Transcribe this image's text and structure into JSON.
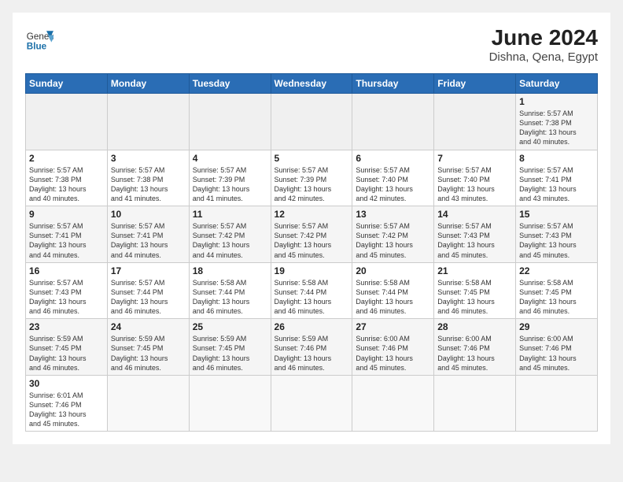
{
  "header": {
    "logo_general": "General",
    "logo_blue": "Blue",
    "month_title": "June 2024",
    "location": "Dishna, Qena, Egypt"
  },
  "weekdays": [
    "Sunday",
    "Monday",
    "Tuesday",
    "Wednesday",
    "Thursday",
    "Friday",
    "Saturday"
  ],
  "weeks": [
    [
      {
        "day": "",
        "info": ""
      },
      {
        "day": "",
        "info": ""
      },
      {
        "day": "",
        "info": ""
      },
      {
        "day": "",
        "info": ""
      },
      {
        "day": "",
        "info": ""
      },
      {
        "day": "",
        "info": ""
      },
      {
        "day": "1",
        "info": "Sunrise: 5:57 AM\nSunset: 7:38 PM\nDaylight: 13 hours\nand 40 minutes."
      }
    ],
    [
      {
        "day": "2",
        "info": "Sunrise: 5:57 AM\nSunset: 7:38 PM\nDaylight: 13 hours\nand 40 minutes."
      },
      {
        "day": "3",
        "info": "Sunrise: 5:57 AM\nSunset: 7:38 PM\nDaylight: 13 hours\nand 41 minutes."
      },
      {
        "day": "4",
        "info": "Sunrise: 5:57 AM\nSunset: 7:39 PM\nDaylight: 13 hours\nand 41 minutes."
      },
      {
        "day": "5",
        "info": "Sunrise: 5:57 AM\nSunset: 7:39 PM\nDaylight: 13 hours\nand 42 minutes."
      },
      {
        "day": "6",
        "info": "Sunrise: 5:57 AM\nSunset: 7:40 PM\nDaylight: 13 hours\nand 42 minutes."
      },
      {
        "day": "7",
        "info": "Sunrise: 5:57 AM\nSunset: 7:40 PM\nDaylight: 13 hours\nand 43 minutes."
      },
      {
        "day": "8",
        "info": "Sunrise: 5:57 AM\nSunset: 7:41 PM\nDaylight: 13 hours\nand 43 minutes."
      }
    ],
    [
      {
        "day": "9",
        "info": "Sunrise: 5:57 AM\nSunset: 7:41 PM\nDaylight: 13 hours\nand 44 minutes."
      },
      {
        "day": "10",
        "info": "Sunrise: 5:57 AM\nSunset: 7:41 PM\nDaylight: 13 hours\nand 44 minutes."
      },
      {
        "day": "11",
        "info": "Sunrise: 5:57 AM\nSunset: 7:42 PM\nDaylight: 13 hours\nand 44 minutes."
      },
      {
        "day": "12",
        "info": "Sunrise: 5:57 AM\nSunset: 7:42 PM\nDaylight: 13 hours\nand 45 minutes."
      },
      {
        "day": "13",
        "info": "Sunrise: 5:57 AM\nSunset: 7:42 PM\nDaylight: 13 hours\nand 45 minutes."
      },
      {
        "day": "14",
        "info": "Sunrise: 5:57 AM\nSunset: 7:43 PM\nDaylight: 13 hours\nand 45 minutes."
      },
      {
        "day": "15",
        "info": "Sunrise: 5:57 AM\nSunset: 7:43 PM\nDaylight: 13 hours\nand 45 minutes."
      }
    ],
    [
      {
        "day": "16",
        "info": "Sunrise: 5:57 AM\nSunset: 7:43 PM\nDaylight: 13 hours\nand 46 minutes."
      },
      {
        "day": "17",
        "info": "Sunrise: 5:57 AM\nSunset: 7:44 PM\nDaylight: 13 hours\nand 46 minutes."
      },
      {
        "day": "18",
        "info": "Sunrise: 5:58 AM\nSunset: 7:44 PM\nDaylight: 13 hours\nand 46 minutes."
      },
      {
        "day": "19",
        "info": "Sunrise: 5:58 AM\nSunset: 7:44 PM\nDaylight: 13 hours\nand 46 minutes."
      },
      {
        "day": "20",
        "info": "Sunrise: 5:58 AM\nSunset: 7:44 PM\nDaylight: 13 hours\nand 46 minutes."
      },
      {
        "day": "21",
        "info": "Sunrise: 5:58 AM\nSunset: 7:45 PM\nDaylight: 13 hours\nand 46 minutes."
      },
      {
        "day": "22",
        "info": "Sunrise: 5:58 AM\nSunset: 7:45 PM\nDaylight: 13 hours\nand 46 minutes."
      }
    ],
    [
      {
        "day": "23",
        "info": "Sunrise: 5:59 AM\nSunset: 7:45 PM\nDaylight: 13 hours\nand 46 minutes."
      },
      {
        "day": "24",
        "info": "Sunrise: 5:59 AM\nSunset: 7:45 PM\nDaylight: 13 hours\nand 46 minutes."
      },
      {
        "day": "25",
        "info": "Sunrise: 5:59 AM\nSunset: 7:45 PM\nDaylight: 13 hours\nand 46 minutes."
      },
      {
        "day": "26",
        "info": "Sunrise: 5:59 AM\nSunset: 7:46 PM\nDaylight: 13 hours\nand 46 minutes."
      },
      {
        "day": "27",
        "info": "Sunrise: 6:00 AM\nSunset: 7:46 PM\nDaylight: 13 hours\nand 45 minutes."
      },
      {
        "day": "28",
        "info": "Sunrise: 6:00 AM\nSunset: 7:46 PM\nDaylight: 13 hours\nand 45 minutes."
      },
      {
        "day": "29",
        "info": "Sunrise: 6:00 AM\nSunset: 7:46 PM\nDaylight: 13 hours\nand 45 minutes."
      }
    ],
    [
      {
        "day": "30",
        "info": "Sunrise: 6:01 AM\nSunset: 7:46 PM\nDaylight: 13 hours\nand 45 minutes."
      },
      {
        "day": "",
        "info": ""
      },
      {
        "day": "",
        "info": ""
      },
      {
        "day": "",
        "info": ""
      },
      {
        "day": "",
        "info": ""
      },
      {
        "day": "",
        "info": ""
      },
      {
        "day": "",
        "info": ""
      }
    ]
  ]
}
